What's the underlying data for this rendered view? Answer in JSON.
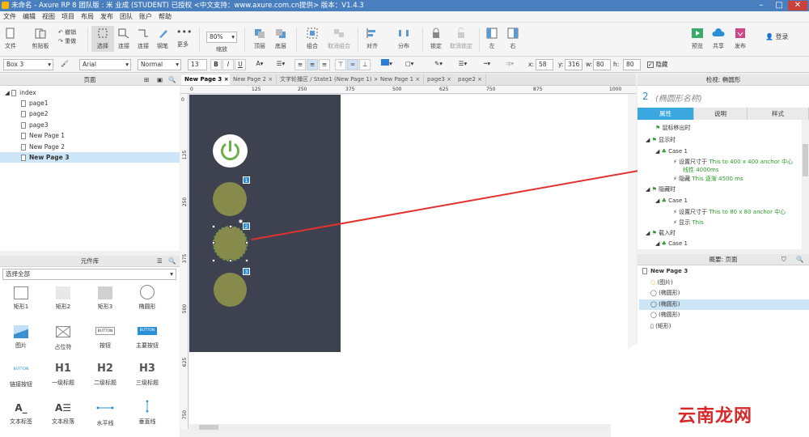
{
  "title": {
    "text": "未命名 - Axure RP 8 团队版 : 米 业成 (STUDENT) 已授权    <中文支持：www.axure.com.cn提供> 版本：V1.4.3"
  },
  "menu": [
    "文件",
    "编辑",
    "视图",
    "项目",
    "布局",
    "发布",
    "团队",
    "账户",
    "帮助"
  ],
  "toolbar": {
    "file": "文件",
    "clipboard": "剪贴板",
    "undo": "撤销",
    "redo": "重做",
    "select": "选择",
    "connect": "连接",
    "pen": "钢笔",
    "more": "更多",
    "zoom_value": "80%",
    "zoom_label": "缩放",
    "top": "顶层",
    "bottom": "底层",
    "group": "组合",
    "ungroup": "取消组合",
    "align": "对齐",
    "distribute": "分布",
    "lock": "锁定",
    "unlock": "取消锁定",
    "left": "左",
    "right": "右",
    "preview": "预览",
    "share": "共享",
    "publish": "发布",
    "login": "登录"
  },
  "format": {
    "widget_name": "Box 3",
    "font": "Arial",
    "style": "Normal",
    "size": "13",
    "bold": "B",
    "italic": "I",
    "underline": "U",
    "x_label": "x:",
    "x": "58",
    "y_label": "y:",
    "y": "316",
    "w_label": "w:",
    "w": "80",
    "h_label": "h:",
    "h": "80",
    "hidden": "隐藏"
  },
  "pages_panel": {
    "title": "页面",
    "items": [
      "index",
      "page1",
      "page2",
      "page3",
      "New Page 1",
      "New Page 2",
      "New Page 3"
    ]
  },
  "library_panel": {
    "title": "元件库",
    "filter": "选择全部",
    "widgets": [
      [
        "矩形1",
        "矩形2",
        "矩形3",
        "椭圆形"
      ],
      [
        "图片",
        "占位符",
        "按钮",
        "主要按钮"
      ],
      [
        "链接按钮",
        "一级标题",
        "二级标题",
        "三级标题"
      ],
      [
        "文本标签",
        "文本段落",
        "水平线",
        "垂直线"
      ]
    ],
    "btn_text": "BUTTON",
    "h1": "H1",
    "h2": "H2",
    "h3": "H3"
  },
  "tabs": [
    "New Page 3",
    "New Page 2",
    "文字轮播区 / State1 (New Page 1)",
    "New Page 1",
    "page3",
    "page2"
  ],
  "ruler": {
    "h": [
      "0",
      "125",
      "250",
      "375",
      "500",
      "625",
      "750",
      "875",
      "1000"
    ],
    "v": [
      "0",
      "125",
      "250",
      "375",
      "500",
      "625",
      "750"
    ]
  },
  "canvas": {
    "badges": [
      "1",
      "2",
      "3"
    ],
    "colors": {
      "bg": "#3d4150",
      "circle": "#868a4a",
      "power": "#6ab04c"
    }
  },
  "inspector": {
    "title": "检视: 椭圆形",
    "number": "2",
    "name_placeholder": "(椭圆形名称)",
    "tabs": [
      "属性",
      "说明",
      "样式"
    ],
    "events": [
      {
        "t": "鼠标移出时"
      },
      {
        "t": "显示时"
      },
      {
        "t": "Case 1"
      },
      {
        "t": "设置尺寸于 ",
        "g": "This to 400 x 400 anchor 中心"
      },
      {
        "t": "",
        "g": "线性 4000ms"
      },
      {
        "t": "隐藏 ",
        "g": "This 逐渐 4500 ms"
      },
      {
        "t": "隐藏时"
      },
      {
        "t": "Case 1"
      },
      {
        "t": "设置尺寸于 ",
        "g": "This to 80 x 80 anchor 中心"
      },
      {
        "t": "显示 ",
        "g": "This"
      },
      {
        "t": "载入时"
      },
      {
        "t": "Case 1"
      }
    ]
  },
  "outline": {
    "title": "概要: 页面",
    "page": "New Page 3",
    "items": [
      "(图片)",
      "(椭圆形)",
      "(椭圆形)",
      "(椭圆形)",
      "(矩形)"
    ]
  },
  "watermark": "云南龙网"
}
